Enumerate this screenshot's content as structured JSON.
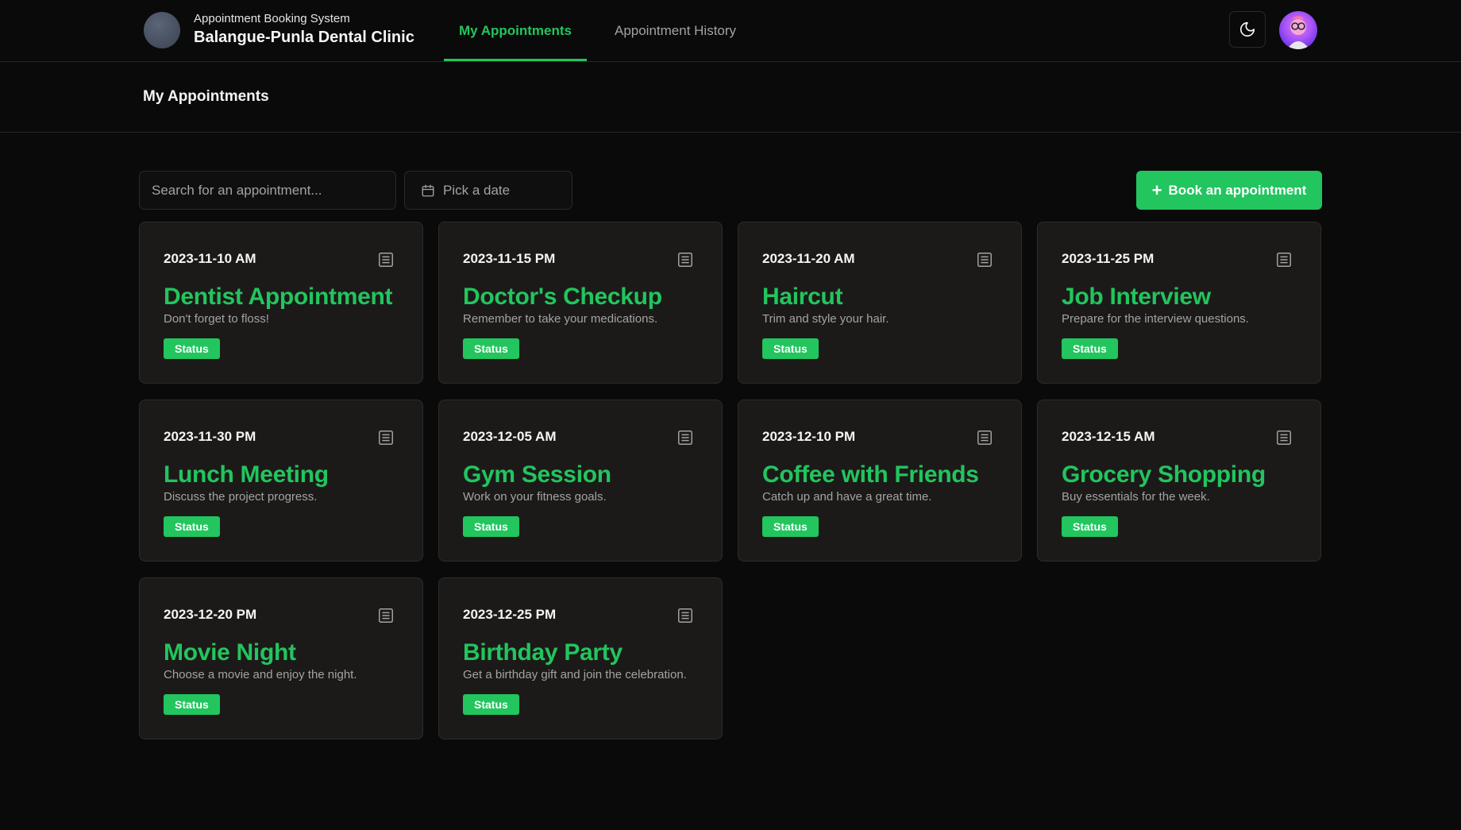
{
  "brand": {
    "subtitle": "Appointment Booking System",
    "title": "Balangue-Punla Dental Clinic"
  },
  "nav": {
    "tabs": [
      {
        "label": "My Appointments",
        "active": true
      },
      {
        "label": "Appointment History",
        "active": false
      }
    ]
  },
  "page": {
    "heading": "My Appointments"
  },
  "toolbar": {
    "search_placeholder": "Search for an appointment...",
    "date_placeholder": "Pick a date",
    "book_label": "Book an appointment"
  },
  "appointments": [
    {
      "date": "2023-11-10 AM",
      "title": "Dentist Appointment",
      "desc": "Don't forget to floss!",
      "status": "Status"
    },
    {
      "date": "2023-11-15 PM",
      "title": "Doctor's Checkup",
      "desc": "Remember to take your medications.",
      "status": "Status"
    },
    {
      "date": "2023-11-20 AM",
      "title": "Haircut",
      "desc": "Trim and style your hair.",
      "status": "Status"
    },
    {
      "date": "2023-11-25 PM",
      "title": "Job Interview",
      "desc": "Prepare for the interview questions.",
      "status": "Status"
    },
    {
      "date": "2023-11-30 PM",
      "title": "Lunch Meeting",
      "desc": "Discuss the project progress.",
      "status": "Status"
    },
    {
      "date": "2023-12-05 AM",
      "title": "Gym Session",
      "desc": "Work on your fitness goals.",
      "status": "Status"
    },
    {
      "date": "2023-12-10 PM",
      "title": "Coffee with Friends",
      "desc": "Catch up and have a great time.",
      "status": "Status"
    },
    {
      "date": "2023-12-15 AM",
      "title": "Grocery Shopping",
      "desc": "Buy essentials for the week.",
      "status": "Status"
    },
    {
      "date": "2023-12-20 PM",
      "title": "Movie Night",
      "desc": "Choose a movie and enjoy the night.",
      "status": "Status"
    },
    {
      "date": "2023-12-25 PM",
      "title": "Birthday Party",
      "desc": "Get a birthday gift and join the celebration.",
      "status": "Status"
    }
  ],
  "icons": {
    "theme_toggle": "moon-icon",
    "date_picker": "calendar-icon",
    "book": "plus-icon",
    "card_action": "list-details-icon",
    "brand_logo": "clinic-logo",
    "user": "user-avatar"
  },
  "colors": {
    "accent": "#22c55e",
    "background": "#0a0a0a",
    "card": "#1c1a19",
    "muted_text": "#a3a3a3"
  }
}
